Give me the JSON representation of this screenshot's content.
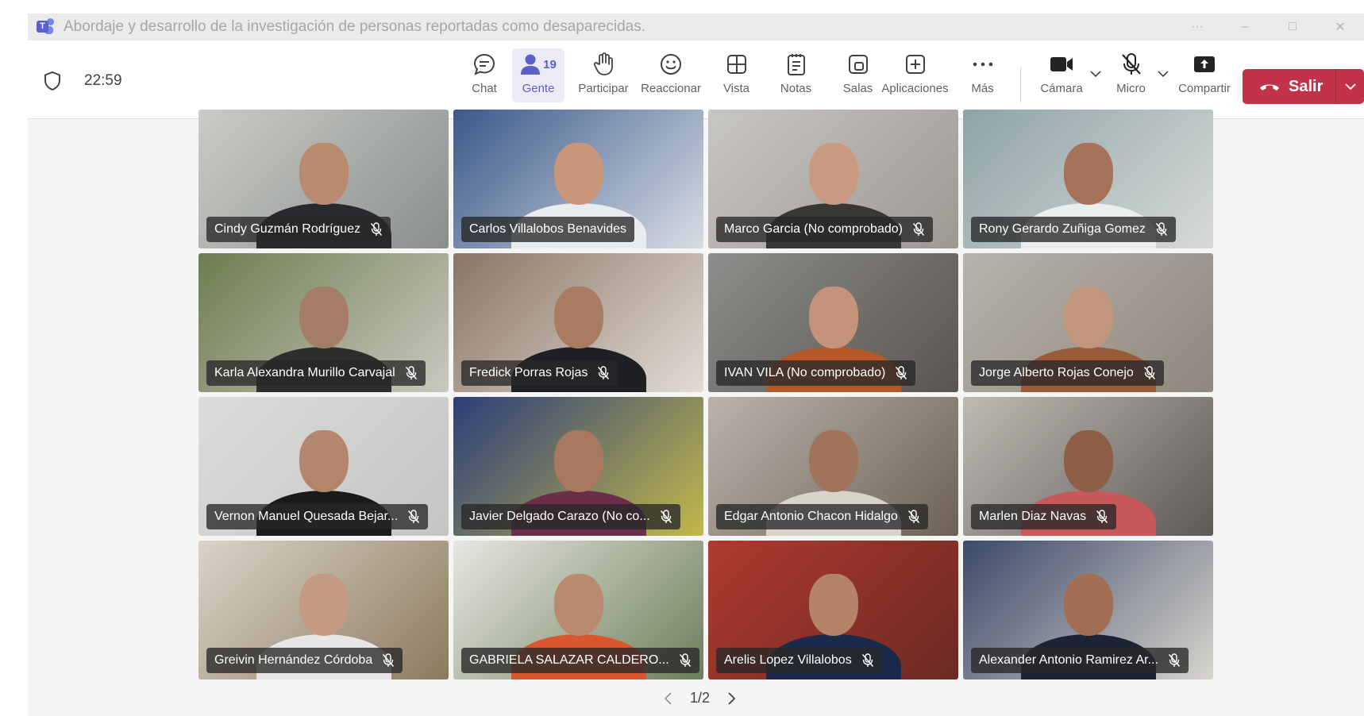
{
  "window": {
    "title": "Abordaje y desarrollo de la investigación de personas reportadas como desaparecidas.",
    "app_icon": "teams-logo-icon"
  },
  "meeting": {
    "timer": "22:59",
    "toolbar": {
      "chat": "Chat",
      "people": "Gente",
      "people_count": "19",
      "raise": "Participar",
      "react": "Reaccionar",
      "view": "Vista",
      "notes": "Notas",
      "rooms": "Salas",
      "apps": "Aplicaciones",
      "more": "Más",
      "camera": "Cámara",
      "mic": "Micro",
      "share": "Compartir",
      "leave": "Salir"
    }
  },
  "participants": [
    {
      "name": "Cindy Guzmán Rodríguez",
      "muted": true,
      "bg": "#c9cbc6",
      "bg2": "#8a8f8c",
      "skin": "#b98a6e",
      "shirt": "#2a2a2e"
    },
    {
      "name": "Carlos Villalobos Benavides",
      "muted": false,
      "bg": "#3b5a8a",
      "bg2": "#d8dde4",
      "skin": "#c89678",
      "shirt": "#e8ecef"
    },
    {
      "name": "Marco Garcia (No comprobado)",
      "muted": true,
      "bg": "#c8c6c2",
      "bg2": "#9c9892",
      "skin": "#c99a80",
      "shirt": "#3a3835"
    },
    {
      "name": "Rony Gerardo Zuñiga Gomez",
      "muted": true,
      "bg": "#8fa3a8",
      "bg2": "#d6dad6",
      "skin": "#a6735a",
      "shirt": "#eaeeee"
    },
    {
      "name": "Karla Alexandra Murillo Carvajal",
      "muted": true,
      "bg": "#6d7d4f",
      "bg2": "#c9c8c0",
      "skin": "#a57c68",
      "shirt": "#2e2f2d"
    },
    {
      "name": "Fredick Porras Rojas",
      "muted": true,
      "bg": "#8a7566",
      "bg2": "#e2dcd4",
      "skin": "#a87b62",
      "shirt": "#1f2024"
    },
    {
      "name": "IVAN VILA (No comprobado)",
      "muted": true,
      "bg": "#8d8d8b",
      "bg2": "#5a5550",
      "skin": "#c4937a",
      "shirt": "#b45a2a"
    },
    {
      "name": "Jorge Alberto Rojas Conejo",
      "muted": true,
      "bg": "#b7b2aa",
      "bg2": "#8e877d",
      "skin": "#c2967c",
      "shirt": "#9a5b3a"
    },
    {
      "name": "Vernon Manuel Quesada Bejar...",
      "muted": true,
      "bg": "#dcdcda",
      "bg2": "#c4c4c2",
      "skin": "#b3876c",
      "shirt": "#1a1a1c"
    },
    {
      "name": "Javier Delgado Carazo (No co...",
      "muted": true,
      "bg": "#2c3f7a",
      "bg2": "#c2b84a",
      "skin": "#a87860",
      "shirt": "#6a2e48"
    },
    {
      "name": "Edgar Antonio Chacon Hidalgo",
      "muted": true,
      "bg": "#b9b3aa",
      "bg2": "#6e6256",
      "skin": "#a0735c",
      "shirt": "#d8d3cb"
    },
    {
      "name": "Marlen Diaz Navas",
      "muted": true,
      "bg": "#bdb9b3",
      "bg2": "#5f5a55",
      "skin": "#8e5e48",
      "shirt": "#c8585a"
    },
    {
      "name": "Greivin Hernández Córdoba",
      "muted": true,
      "bg": "#d9d3c8",
      "bg2": "#8b7a5e",
      "skin": "#c49a82",
      "shirt": "#e6e6e4"
    },
    {
      "name": "GABRIELA SALAZAR CALDERO...",
      "muted": true,
      "bg": "#e8e6e0",
      "bg2": "#6b7f5a",
      "skin": "#b98a6e",
      "shirt": "#d8572f"
    },
    {
      "name": "Arelis Lopez Villalobos",
      "muted": true,
      "bg": "#b03a2e",
      "bg2": "#6b2a24",
      "skin": "#b58468",
      "shirt": "#1b2a4a"
    },
    {
      "name": "Alexander Antonio Ramirez Ar...",
      "muted": true,
      "bg": "#3c4a6a",
      "bg2": "#d7d4cc",
      "skin": "#a26f55",
      "shirt": "#1d2436"
    }
  ],
  "pager": {
    "label": "1/2"
  }
}
